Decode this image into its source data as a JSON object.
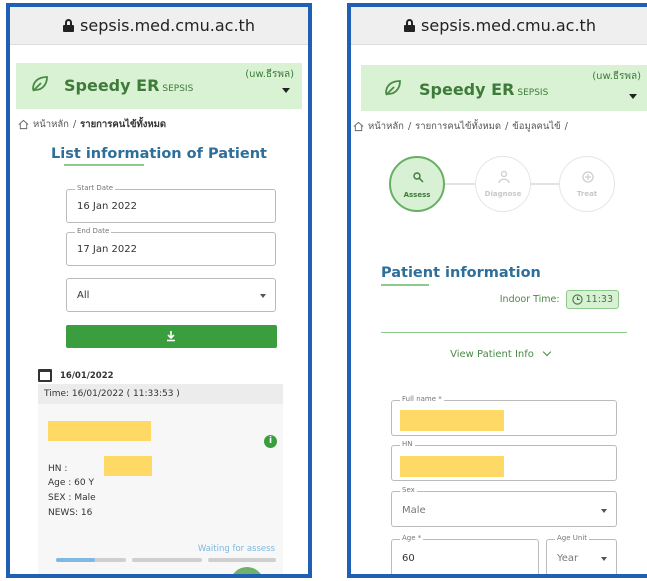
{
  "url": "sepsis.med.cmu.ac.th",
  "brand": {
    "name": "Speedy ER",
    "sub": "SEPSIS",
    "user": "(uw.ธีรพล)"
  },
  "left": {
    "breadcrumb": [
      "หน้าหลัก",
      "/",
      "รายการคนไข้ทั้งหมด"
    ],
    "title": "List information of Patient",
    "start_date": {
      "label": "Start Date",
      "value": "16 Jan 2022"
    },
    "end_date": {
      "label": "End Date",
      "value": "17 Jan 2022"
    },
    "filter": {
      "value": "All"
    },
    "date_header": "16/01/2022",
    "card": {
      "time": "Time: 16/01/2022 ( 11:33:53 )",
      "info": "i",
      "hn": "HN :",
      "age": "Age : 60 Y",
      "sex": "SEX : Male",
      "news": "NEWS: 16",
      "status": "Waiting for assess",
      "progress": [
        0.55,
        0,
        0
      ]
    }
  },
  "right": {
    "breadcrumb": [
      "หน้าหลัก",
      "/",
      "รายการคนไข้ทั้งหมด",
      "/",
      "ข้อมูลคนไข้",
      "/"
    ],
    "steps": [
      "Assess",
      "Diagnose",
      "Treat"
    ],
    "active_step": 0,
    "section_title": "Patient information",
    "indoor_label": "Indoor Time:",
    "indoor_time": "11:33",
    "view_info": "View Patient Info",
    "fields": {
      "fullname": {
        "label": "Full name *",
        "value": ""
      },
      "hn": {
        "label": "HN",
        "value": ""
      },
      "sex": {
        "label": "Sex",
        "value": "Male"
      },
      "age": {
        "label": "Age *",
        "value": "60"
      },
      "age_unit": {
        "label": "Age Unit",
        "value": "Year"
      }
    }
  },
  "colors": {
    "frame": "#1f5fb4",
    "brand_green": "#3e7a3a",
    "title_blue": "#2e6f9a",
    "button_green": "#3a9e3f",
    "redaction": "#ffd966"
  }
}
